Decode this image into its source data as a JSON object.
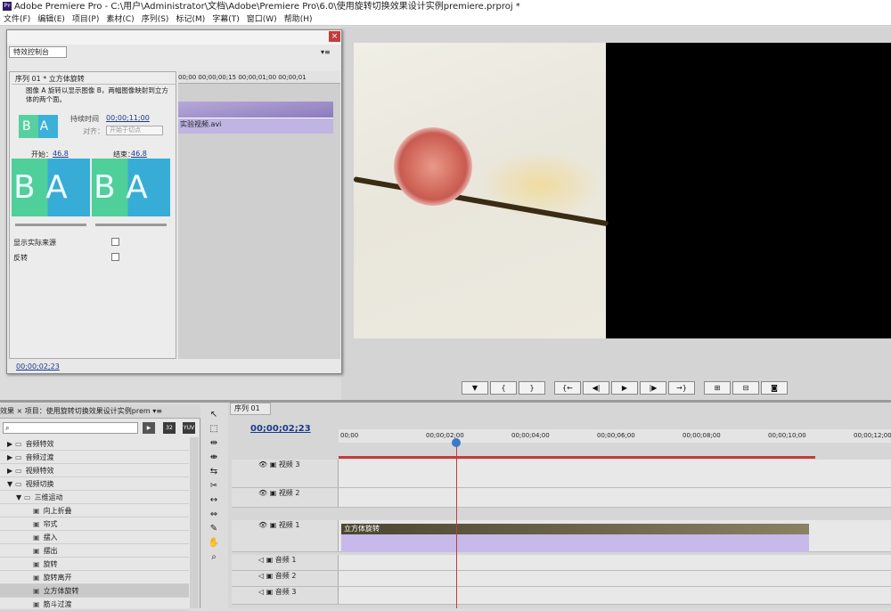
{
  "window": {
    "title": "Adobe Premiere Pro - C:\\用户\\Administrator\\文档\\Adobe\\Premiere Pro\\6.0\\使用旋转切换效果设计实例premiere.prproj *",
    "icon": "Pr"
  },
  "menu": [
    "文件(F)",
    "编辑(E)",
    "项目(P)",
    "素材(C)",
    "序列(S)",
    "标记(M)",
    "字幕(T)",
    "窗口(W)",
    "帮助(H)"
  ],
  "effect_controls": {
    "tab": "特效控制台",
    "menu_icon": "▾≡",
    "close": "×",
    "sequence_header": "序列 01 * 立方体旋转",
    "description": "图像 A 旋转以显示图像 B，两幅图像映射到立方体的两个面。",
    "duration_label": "持续时间",
    "duration_value": "00;00;11;00",
    "align_label": "对齐：",
    "align_value": "开始于切点",
    "start_label": "开始：",
    "start_value": "46.8",
    "end_label": "结束：",
    "end_value": "46.8",
    "thumb_text": "BA",
    "preview_a_text": "B A",
    "preview_b_text": "B A",
    "show_source_label": "显示实际来源",
    "reverse_label": "反转",
    "ruler": "00;00    00;00;00;15    00;00;01;00    00;00;01",
    "clip_label": "实验视频.avi",
    "timecode": "00;00;02;23"
  },
  "effects": {
    "tabs": "效果 ×   项目：使用旋转切换效果设计实例prem ▾≡",
    "search_placeholder": "",
    "buttons": [
      "32",
      "YUV"
    ],
    "items": [
      {
        "label": "音频特效",
        "indent": 1,
        "arrow": "▶"
      },
      {
        "label": "音频过渡",
        "indent": 1,
        "arrow": "▶"
      },
      {
        "label": "视频特效",
        "indent": 1,
        "arrow": "▶"
      },
      {
        "label": "视频切换",
        "indent": 1,
        "arrow": "▼"
      },
      {
        "label": "三维运动",
        "indent": 2,
        "arrow": "▼"
      },
      {
        "label": "向上折叠",
        "indent": 3,
        "arrow": ""
      },
      {
        "label": "帘式",
        "indent": 3,
        "arrow": ""
      },
      {
        "label": "摆入",
        "indent": 3,
        "arrow": ""
      },
      {
        "label": "摆出",
        "indent": 3,
        "arrow": ""
      },
      {
        "label": "旋转",
        "indent": 3,
        "arrow": ""
      },
      {
        "label": "旋转离开",
        "indent": 3,
        "arrow": ""
      },
      {
        "label": "立方体旋转",
        "indent": 3,
        "arrow": "",
        "selected": true
      },
      {
        "label": "筋斗过渡",
        "indent": 3,
        "arrow": ""
      }
    ]
  },
  "timeline": {
    "tab": "序列 01",
    "timecode": "00;00;02;23",
    "ruler": [
      "00;00",
      "00;00;02;00",
      "00;00;04;00",
      "00;00;06;00",
      "00;00;08;00",
      "00;00;10;00",
      "00;00;12;00"
    ],
    "tracks": [
      "视频 3",
      "视频 2",
      "视频 1",
      "音频 1",
      "音频 2",
      "音频 3"
    ],
    "clip_title": "立方体旋转"
  },
  "transport": [
    "▼",
    "{",
    "}",
    "{←",
    "◀|",
    "▶",
    "|▶",
    "→}",
    "⊞",
    "⊟",
    "◙"
  ]
}
